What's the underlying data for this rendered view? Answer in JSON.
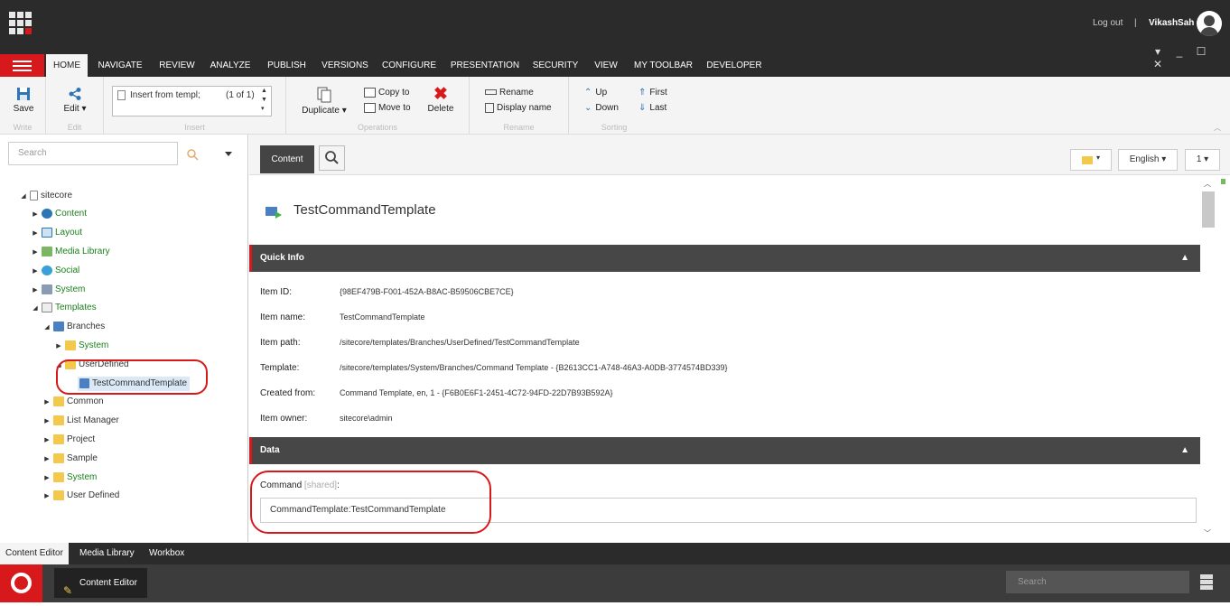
{
  "topbar": {
    "logout": "Log out",
    "separator": "|",
    "username": "VikashSah"
  },
  "ribbon_tabs": [
    "HOME",
    "NAVIGATE",
    "REVIEW",
    "ANALYZE",
    "PUBLISH",
    "VERSIONS",
    "CONFIGURE",
    "PRESENTATION",
    "SECURITY",
    "VIEW",
    "MY TOOLBAR",
    "DEVELOPER"
  ],
  "window_controls": {
    "dropdown": "▾",
    "minimize": "_",
    "maximize": "☐",
    "close": "✕"
  },
  "ribbon": {
    "save": "Save",
    "write": "Write",
    "edit": "Edit",
    "edit_group": "Edit",
    "insert_item": "Insert from templ;",
    "insert_count": "(1 of 1)",
    "insert_group": "Insert",
    "duplicate": "Duplicate",
    "copy_to": "Copy to",
    "move_to": "Move to",
    "delete": "Delete",
    "operations_group": "Operations",
    "rename": "Rename",
    "display_name": "Display name",
    "rename_group": "Rename",
    "up": "Up",
    "down": "Down",
    "first": "First",
    "last": "Last",
    "sorting_group": "Sorting"
  },
  "search": {
    "placeholder": "Search"
  },
  "tree": [
    {
      "label": "sitecore",
      "green": false
    },
    {
      "label": "Content",
      "green": true
    },
    {
      "label": "Layout",
      "green": true
    },
    {
      "label": "Media Library",
      "green": true
    },
    {
      "label": "Social",
      "green": true
    },
    {
      "label": "System",
      "green": true
    },
    {
      "label": "Templates",
      "green": true
    },
    {
      "label": "Branches",
      "green": false
    },
    {
      "label": "System",
      "green": true
    },
    {
      "label": "UserDefined",
      "green": false
    },
    {
      "label": "TestCommandTemplate",
      "green": false
    },
    {
      "label": "Common",
      "green": false
    },
    {
      "label": "List Manager",
      "green": false
    },
    {
      "label": "Project",
      "green": false
    },
    {
      "label": "Sample",
      "green": false
    },
    {
      "label": "System",
      "green": true
    },
    {
      "label": "User Defined",
      "green": false
    }
  ],
  "content_header": {
    "content_tab": "Content",
    "language": "English",
    "version": "1"
  },
  "item": {
    "title": "TestCommandTemplate"
  },
  "quick_info": {
    "title": "Quick Info",
    "rows": [
      {
        "label": "Item ID:",
        "value": "{98EF479B-F001-452A-B8AC-B59506CBE7CE}"
      },
      {
        "label": "Item name:",
        "value": "TestCommandTemplate"
      },
      {
        "label": "Item path:",
        "value": "/sitecore/templates/Branches/UserDefined/TestCommandTemplate"
      },
      {
        "label": "Template:",
        "value": "/sitecore/templates/System/Branches/Command Template - {B2613CC1-A748-46A3-A0DB-3774574BD339}"
      },
      {
        "label": "Created from:",
        "value": "Command Template, en, 1 - {F6B0E6F1-2451-4C72-94FD-22D7B93B592A}"
      },
      {
        "label": "Item owner:",
        "value": "sitecore\\admin"
      }
    ]
  },
  "data_section": {
    "title": "Data",
    "field_label": "Command",
    "field_shared": "[shared]",
    "field_colon": ":",
    "field_value": "CommandTemplate:TestCommandTemplate"
  },
  "bottom_tabs": [
    "Content Editor",
    "Media Library",
    "Workbox"
  ],
  "taskbar": {
    "active_app": "Content Editor",
    "search_placeholder": "Search"
  },
  "colors": {
    "accent": "#d8191b",
    "dark": "#2b2b2b",
    "tree_green": "#1a7f1a"
  }
}
